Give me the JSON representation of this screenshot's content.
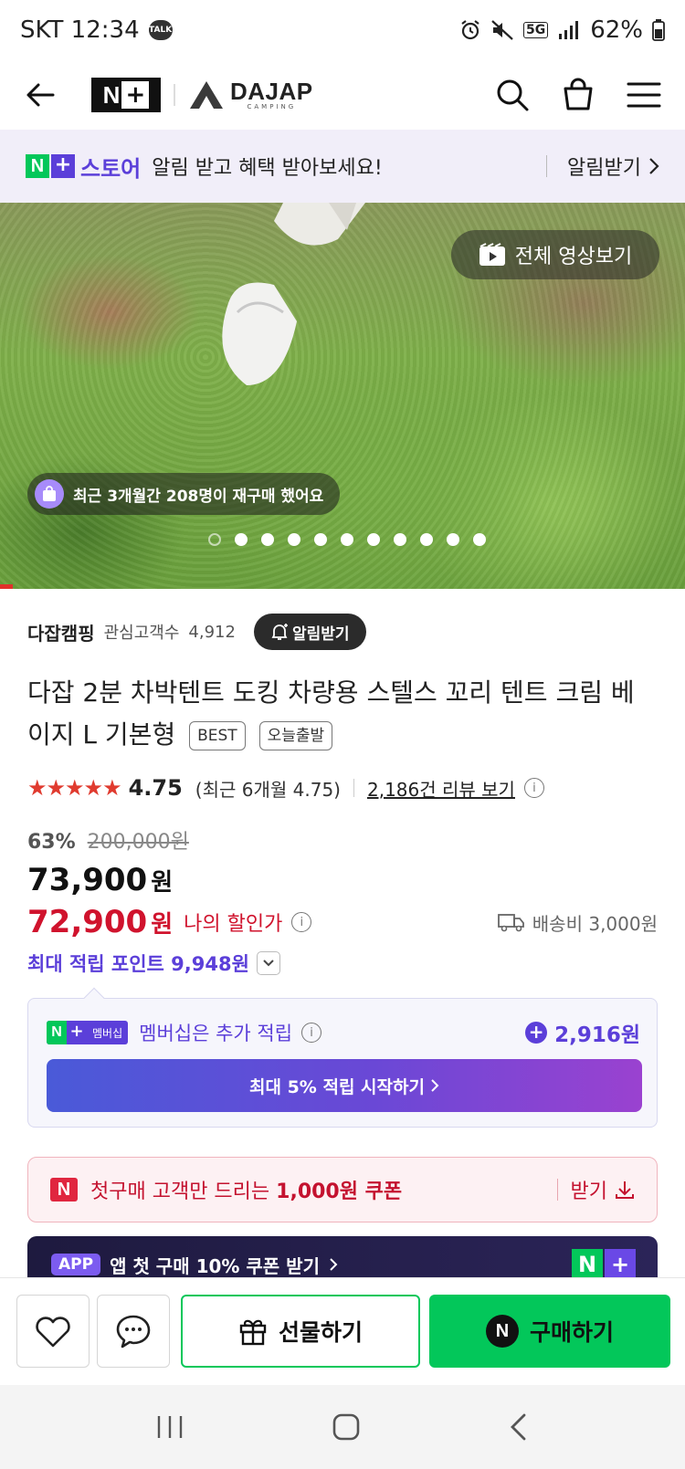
{
  "status_bar": {
    "carrier_time": "SKT 12:34",
    "talk_badge": "TALK",
    "network": "5G",
    "battery": "62%"
  },
  "header": {
    "nplus_n": "N",
    "nplus_plus": "+",
    "brand_name": "DAJAP",
    "brand_sub": "CAMPING"
  },
  "store_banner": {
    "badge_n": "N",
    "badge_plus": "+",
    "store_name": "스토어",
    "message": "알림 받고 혜택 받아보세요!",
    "link_label": "알림받기"
  },
  "hero": {
    "video_button": "전체 영상보기",
    "rebuy_text": "최근 3개월간 208명이 재구매 했어요",
    "slide_count": 11,
    "current_slide": 1
  },
  "seller": {
    "name": "다잡캠핑",
    "fans_label": "관심고객수",
    "fans_count": "4,912",
    "alarm_button": "알림받기"
  },
  "product": {
    "title": "다잡 2분 차박텐트 도킹 차량용 스텔스 꼬리 텐트 크림 베이지 L 기본형",
    "tags": [
      "BEST",
      "오늘출발"
    ]
  },
  "rating": {
    "stars": "★★★★★",
    "score": "4.75",
    "recent": "(최근 6개월 4.75)",
    "review_link": "2,186건 리뷰 보기"
  },
  "price": {
    "discount_rate": "63%",
    "original": "200,000원",
    "sale": "73,900",
    "sale_unit": "원",
    "my_price": "72,900",
    "my_price_unit": "원",
    "my_price_label": "나의 할인가",
    "shipping": "배송비 3,000원",
    "points": "최대 적립 포인트 9,948원"
  },
  "membership": {
    "badge_n": "N",
    "badge_plus": "+",
    "badge_text": "멤버십",
    "message": "멤버십은 추가 적립",
    "points": "2,916원",
    "cta": "최대 5% 적립 시작하기"
  },
  "coupon": {
    "badge": "N",
    "text_prefix": "첫구매 고객만 드리는",
    "text_bold": "1,000원 쿠폰",
    "action": "받기"
  },
  "app_banner": {
    "tag": "APP",
    "text": "앱 첫 구매 10% 쿠폰 받기",
    "logo_n": "N",
    "logo_plus": "+"
  },
  "action_bar": {
    "gift_label": "선물하기",
    "buy_label": "구매하기",
    "buy_badge": "N"
  },
  "colors": {
    "naver_green": "#03c75a",
    "store_purple": "#5b3fd9",
    "price_red": "#d0132d",
    "star_red": "#e03b2f"
  }
}
